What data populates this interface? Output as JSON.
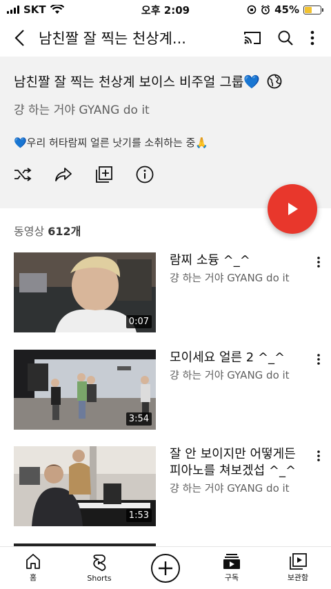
{
  "status_bar": {
    "carrier": "SKT",
    "time": "오후 2:09",
    "battery": "45%"
  },
  "top_bar": {
    "title": "남친짤 잘 찍는 천상계..."
  },
  "playlist": {
    "title": "남친짤 잘 찍는 천상계 보이스 비주얼 그룹💙",
    "channel": "걍 하는 거야 GYANG do it",
    "description": "💙우리 허타람찌 얼른 낫기를 소취하는 중🙏",
    "count_label": "동영상",
    "count_value": "612개"
  },
  "videos": [
    {
      "title": "람찌 소듕 ^_^",
      "channel": "걍 하는 거야 GYANG do it",
      "duration": "0:07"
    },
    {
      "title": "모이세요 얼른 2  ^_^",
      "channel": "걍 하는 거야 GYANG do it",
      "duration": "3:54"
    },
    {
      "title": "잘 안 보이지만 어떻게든 피아노를 쳐보겠섭 ^_^",
      "channel": "걍 하는 거야 GYANG do it",
      "duration": "1:53"
    }
  ],
  "bottom_nav": [
    {
      "label": "홈",
      "icon": "home-icon"
    },
    {
      "label": "Shorts",
      "icon": "shorts-icon"
    },
    {
      "label": "",
      "icon": "create-icon"
    },
    {
      "label": "구독",
      "icon": "subscriptions-icon"
    },
    {
      "label": "보관함",
      "icon": "library-icon"
    }
  ],
  "colors": {
    "play_button": "#e8372c",
    "header_bg": "#f2f2f2",
    "battery": "#f2c230"
  }
}
